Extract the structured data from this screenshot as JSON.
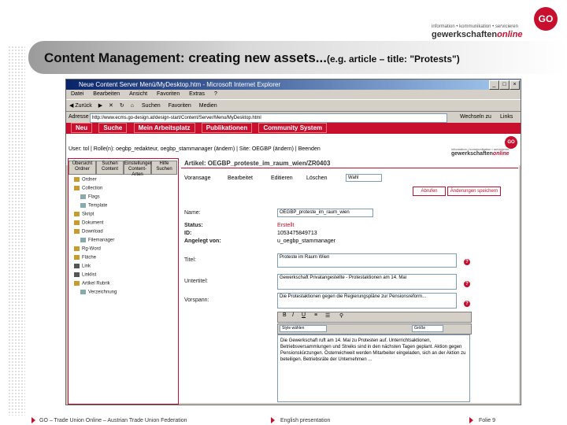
{
  "brand": {
    "logo": "GO",
    "tagline": "information • kommunikation • servicieren",
    "name_main": "gewerkschaften",
    "name_accent": "online"
  },
  "slide": {
    "title": "Content Management: creating new assets...",
    "subtitle": "(e.g. article – title: \"Protests\")"
  },
  "browser": {
    "window_title": "Neue Content Server Menü/MyDesktop.htm - Microsoft Internet Explorer",
    "menu": [
      "Datei",
      "Bearbeiten",
      "Ansicht",
      "Favoriten",
      "Extras",
      "?"
    ],
    "toolbar": [
      "Zurück",
      "Suchen",
      "Favoriten",
      "Medien"
    ],
    "address_label": "Adresse",
    "address_value": "http://www.ecms.go-design.at/design-start/Content/Server/Menu/MyDesktop.html",
    "go_label": "Wechseln zu",
    "links_label": "Links"
  },
  "cms": {
    "nav": [
      "Neu",
      "Suche",
      "Mein Arbeitsplatz",
      "Publikationen",
      "Community System"
    ],
    "user_bar": "User: tol | Rolle(n): oegbp_redakteur, oegbp_stammanager (ändern) | Site: OEGBP (ändern) | Beenden",
    "left_tabs": [
      "Übersicht Ordner",
      "Suchen Content",
      "Einstellungen Content-Arten",
      "Hilfe Suchen"
    ],
    "tree": [
      "Ordner",
      "Collection",
      "Flags",
      "Template",
      "Skript",
      "Dokument",
      "Download",
      "Filemanager",
      "Rg-Word",
      "Fläche",
      "Link",
      "Linklist",
      "Artikel Rubrik",
      "Verzeichnung"
    ],
    "article_header": "Artikel: OEGBP_proteste_im_raum_wien/ZR0403",
    "actions": [
      "Voransage",
      "Bearbeitet",
      "Editieren",
      "Löschen"
    ],
    "action_select": "Wahl",
    "btn_save": "Abrufen",
    "btn_save_close": "Änderungen speichern",
    "fields": {
      "name_label": "Name:",
      "name_value": "OEGBP_proteste_im_raum_wien",
      "status_label": "Status:",
      "status_value": "Erstellt",
      "id_label": "ID:",
      "id_value": "1053475849713",
      "created_label": "Angelegt von:",
      "created_value": "u_oegbp_stammanager",
      "title_label": "Titel:",
      "title_value": "Proteste im Raum Wien",
      "subtitle_label": "Untertitel:",
      "subtitle_value": "Gewerkschaft Privatangestellte - Protestaktionen am 14. Mai",
      "lead_label": "Vorspann:",
      "lead_value": "Die Protestaktionen gegen die Regierungspläne zur Pensionsreform...",
      "body_value": "Die Gewerkschaft ruft am 14. Mai zu Protesten auf. Unterrichtsaktionen, Betriebsversammlungen und Streiks sind in den nächsten Tagen geplant. Aktion gegen Pensionskürzungen. Österreichweit werden Mitarbeiter eingeladen, sich an der Aktion zu beteiligen. Betriebsräte der Unternehmen ..."
    },
    "editor_style": "Style wählen",
    "editor_size": "Größe"
  },
  "footer": {
    "left": "GO – Trade Union Online – Austrian Trade Union Federation",
    "center": "English presentation",
    "right": "Folie 9"
  },
  "colors": {
    "brand_red": "#c8102e",
    "ie_title": "#0a246a"
  }
}
